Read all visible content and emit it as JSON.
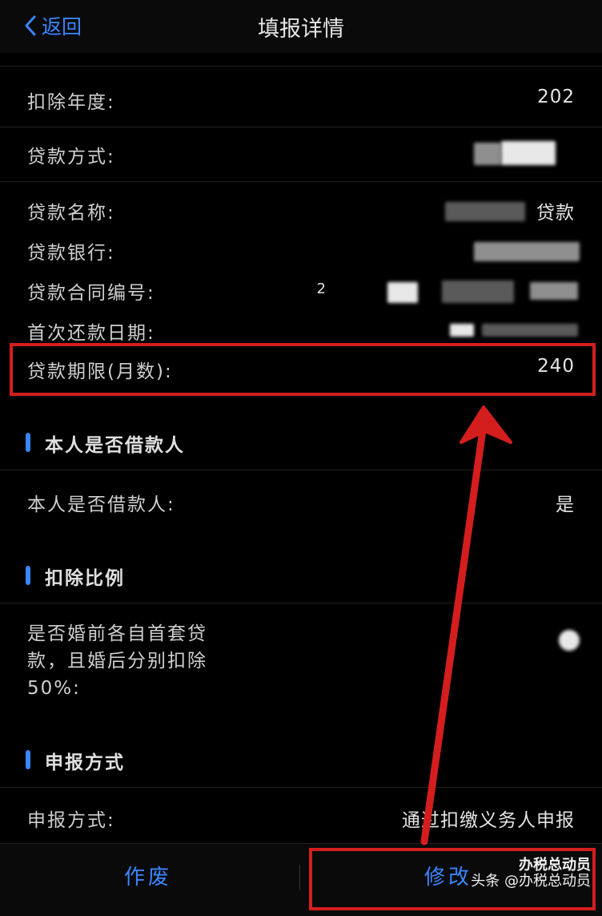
{
  "nav": {
    "back_label": "返回",
    "title": "填报详情"
  },
  "loan_info": {
    "year_label": "扣除年度:",
    "year_value": "202",
    "method_label": "贷款方式:",
    "name_label": "贷款名称:",
    "name_value": "贷款",
    "bank_label": "贷款银行:",
    "contract_label": "贷款合同编号:",
    "contract_value": "2",
    "first_repay_label": "首次还款日期:",
    "term_label": "贷款期限(月数):",
    "term_value": "240"
  },
  "borrower": {
    "section_title": "本人是否借款人",
    "label": "本人是否借款人:",
    "value": "是"
  },
  "ratio": {
    "section_title": "扣除比例",
    "label_line1": "是否婚前各自首套贷",
    "label_line2": "款，且婚后分别扣除",
    "label_line3": "50%:"
  },
  "declare": {
    "section_title": "申报方式",
    "label": "申报方式:",
    "value": "通过扣缴义务人申报"
  },
  "footer": {
    "void_label": "作废",
    "modify_label": "修改"
  },
  "watermark": {
    "line1": "办税总动员",
    "line2": "头条 @办税总动员"
  },
  "colors": {
    "accent": "#3a86ff",
    "highlight": "#d41e1e"
  }
}
